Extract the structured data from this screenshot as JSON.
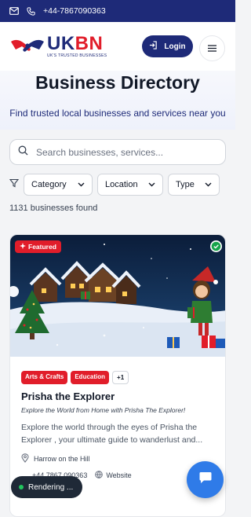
{
  "topbar": {
    "phone": "+44-7867090363"
  },
  "header": {
    "logo_main_uk": "UK",
    "logo_main_bn": "BN",
    "logo_tagline": "UK'S TRUSTED BUSINESSES",
    "login_label": "Login"
  },
  "hero": {
    "title": "Business Directory",
    "subtitle": "Find trusted local businesses and services near you"
  },
  "search": {
    "placeholder": "Search businesses, services..."
  },
  "filters": {
    "category": "Category",
    "location": "Location",
    "type": "Type"
  },
  "results": {
    "count_text": "1131 businesses found"
  },
  "card": {
    "featured_label": "Featured",
    "tags": [
      "Arts & Crafts",
      "Education"
    ],
    "more_tags": "+1",
    "name": "Prisha the Explorer",
    "tagline": "Explore the World from Home with Prisha The Explorer!",
    "description": "Explore the world through the eyes of Prisha the Explorer , your ultimate guide to wanderlust and...",
    "location": "Harrow on the Hill",
    "phone": "+44 7867 090363",
    "website_label": "Website"
  },
  "status": {
    "rendering": "Rendering ..."
  },
  "colors": {
    "brand_navy": "#1e2a78",
    "brand_red": "#e11d2a",
    "chat_blue": "#2f7be8"
  }
}
